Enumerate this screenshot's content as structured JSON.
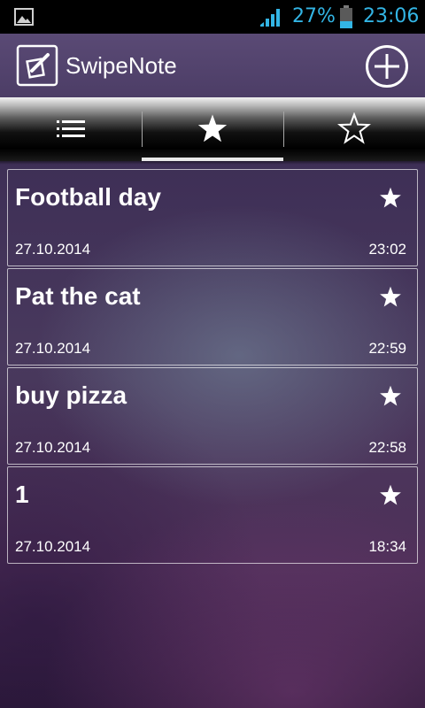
{
  "status_bar": {
    "battery_percent": "27%",
    "time": "23:06",
    "icons": [
      "gallery-icon",
      "signal-icon",
      "battery-icon"
    ],
    "accent_color": "#33b5e5"
  },
  "action_bar": {
    "title": "SwipeNote",
    "app_icon": "note-pencil-icon",
    "add_icon": "plus-circle-icon"
  },
  "tabs": [
    {
      "icon": "list-icon",
      "selected": false
    },
    {
      "icon": "star-filled-icon",
      "selected": true
    },
    {
      "icon": "star-outline-icon",
      "selected": false
    }
  ],
  "notes": [
    {
      "title": "Football day",
      "date": "27.10.2014",
      "time": "23:02",
      "starred": true
    },
    {
      "title": "Pat the cat",
      "date": "27.10.2014",
      "time": "22:59",
      "starred": true
    },
    {
      "title": "buy pizza",
      "date": "27.10.2014",
      "time": "22:58",
      "starred": true
    },
    {
      "title": "1",
      "date": "27.10.2014",
      "time": "18:34",
      "starred": true
    }
  ]
}
